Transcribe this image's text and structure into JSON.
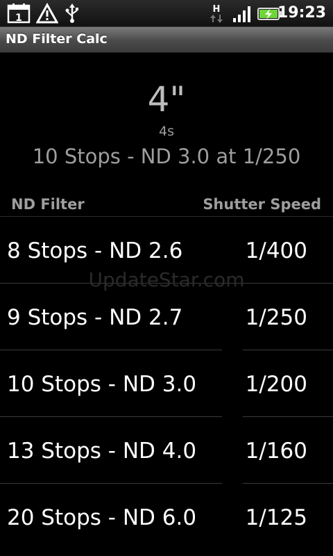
{
  "status_bar": {
    "clock": "19:23",
    "calendar_day": "1",
    "network_letter": "H",
    "icons": [
      "calendar-icon",
      "warning-icon",
      "usb-icon",
      "network-h-icon",
      "signal-icon",
      "battery-charging-icon"
    ]
  },
  "app": {
    "title": "ND Filter Calc"
  },
  "result": {
    "time": "4\"",
    "seconds": "4s",
    "description": "10 Stops - ND 3.0 at 1/250"
  },
  "table": {
    "headers": {
      "filter": "ND Filter",
      "speed": "Shutter Speed"
    },
    "rows": [
      {
        "filter": "8 Stops - ND 2.6",
        "speed": "1/400"
      },
      {
        "filter": "9 Stops - ND 2.7",
        "speed": "1/250"
      },
      {
        "filter": "10 Stops - ND 3.0",
        "speed": "1/200"
      },
      {
        "filter": "13 Stops - ND 4.0",
        "speed": "1/160"
      },
      {
        "filter": "20 Stops - ND 6.0",
        "speed": "1/125"
      }
    ]
  },
  "watermark": "UpdateStar.com",
  "colors": {
    "battery_fill": "#6fd63a",
    "title_bar": "#4a4a4a"
  }
}
